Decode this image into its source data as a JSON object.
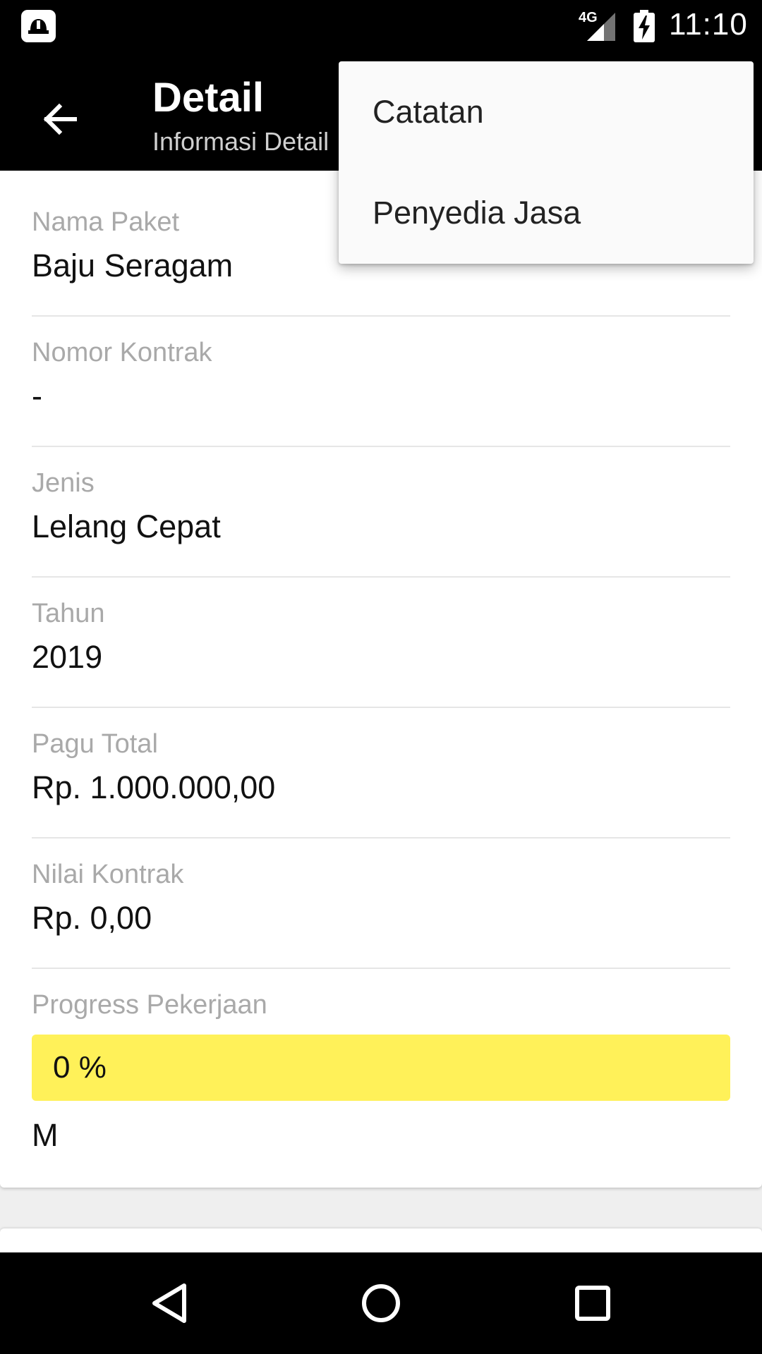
{
  "status_bar": {
    "app_icon": "helmet-icon",
    "network": "4G",
    "time": "11:10"
  },
  "app_bar": {
    "title": "Detail",
    "subtitle": "Informasi Detail"
  },
  "fields": [
    {
      "label": "Nama Paket",
      "value": "Baju Seragam"
    },
    {
      "label": "Nomor Kontrak",
      "value": "-"
    },
    {
      "label": "Jenis",
      "value": "Lelang Cepat"
    },
    {
      "label": "Tahun",
      "value": "2019"
    },
    {
      "label": "Pagu Total",
      "value": "Rp. 1.000.000,00"
    },
    {
      "label": "Nilai Kontrak",
      "value": "Rp. 0,00"
    }
  ],
  "progress": {
    "label": "Progress Pekerjaan",
    "value_text": "0 %",
    "percent": 0,
    "bar_color": "#fff159",
    "extra_text": "M"
  },
  "overflow_menu": {
    "items": [
      "Catatan",
      "Penyedia Jasa"
    ]
  }
}
